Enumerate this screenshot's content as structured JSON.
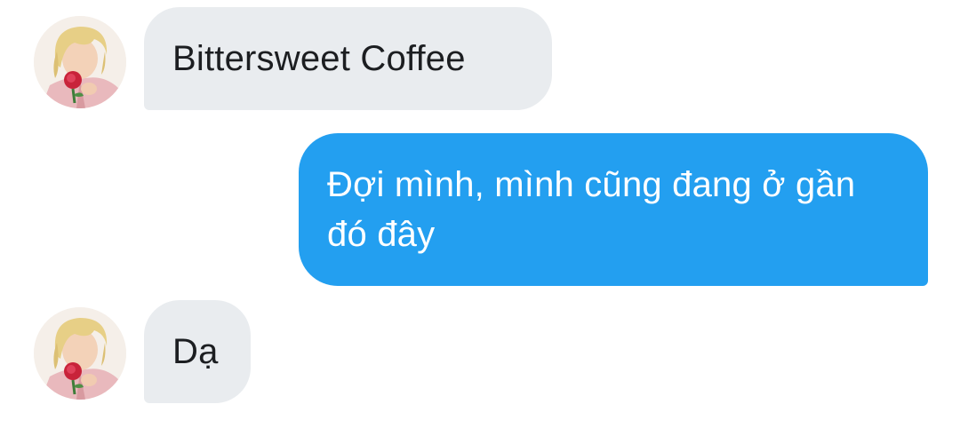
{
  "messages": [
    {
      "direction": "incoming",
      "text": "Bittersweet Coffee"
    },
    {
      "direction": "outgoing",
      "text": "Đợi mình, mình cũng đang ở gần đó đây"
    },
    {
      "direction": "incoming",
      "text": "Dạ"
    }
  ],
  "colors": {
    "incoming_bubble": "#e9ecef",
    "outgoing_bubble": "#239ff0",
    "incoming_text": "#1c1e21",
    "outgoing_text": "#ffffff"
  },
  "icons": {
    "avatar": "contact-avatar-photo"
  }
}
